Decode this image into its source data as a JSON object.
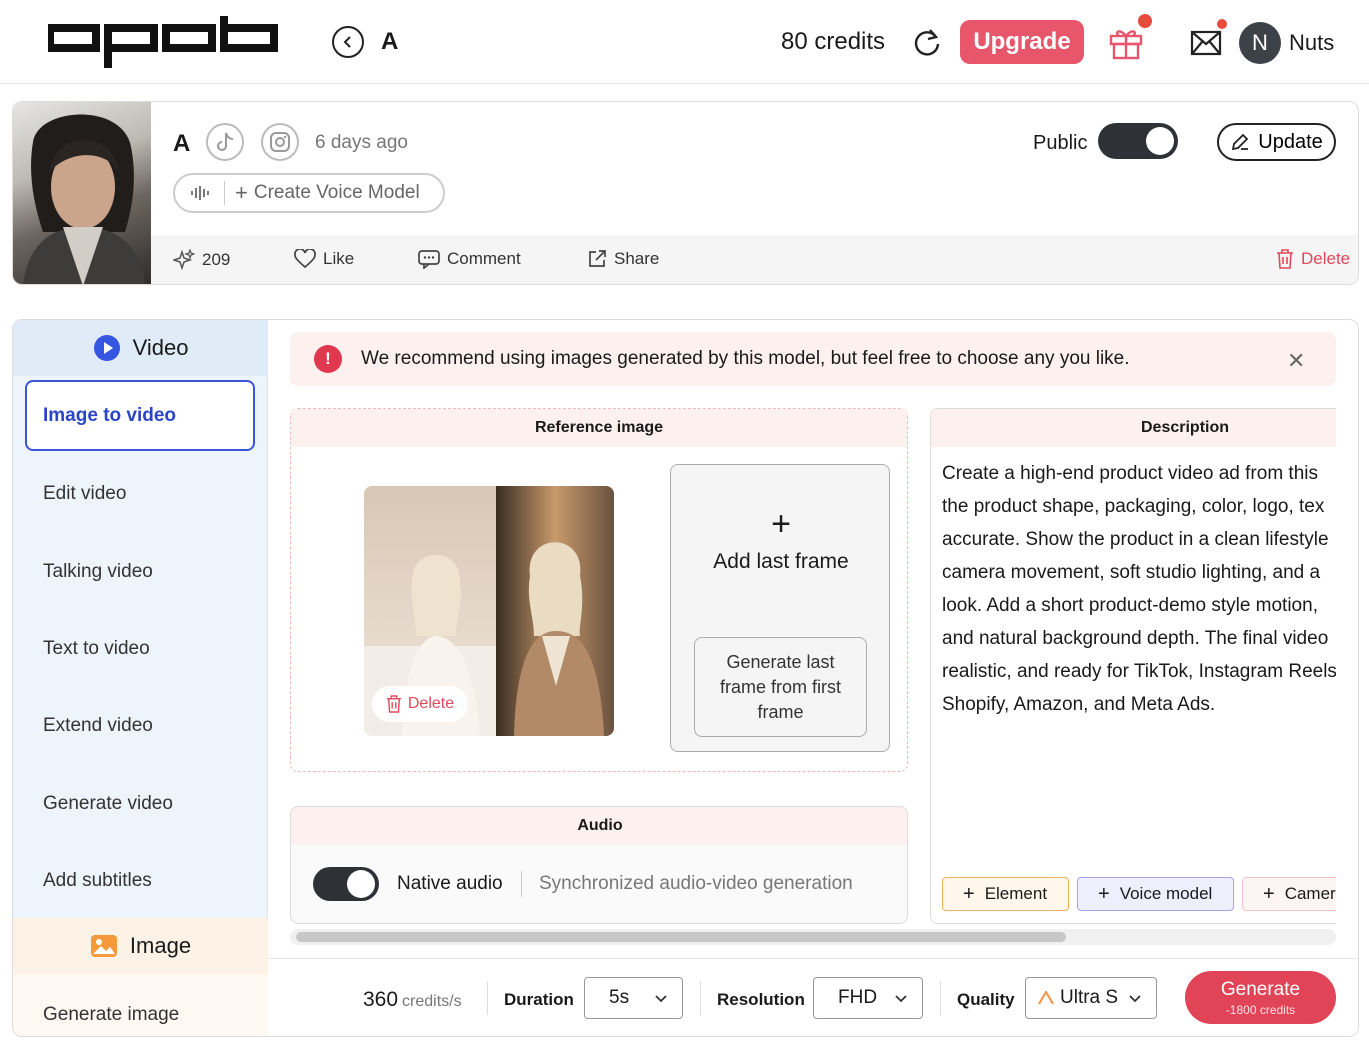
{
  "header": {
    "title": "A",
    "credits": "80 credits",
    "upgrade_label": "Upgrade",
    "avatar_initial": "N",
    "username": "Nuts"
  },
  "profile": {
    "name": "A",
    "time_ago": "6 days ago",
    "voice_model_label": "Create Voice Model",
    "public_label": "Public",
    "public_on": true,
    "update_label": "Update",
    "actions": {
      "generations": "209",
      "like": "Like",
      "comment": "Comment",
      "share": "Share",
      "delete": "Delete"
    }
  },
  "sidebar": {
    "video_heading": "Video",
    "video_items": [
      "Image to video",
      "Edit video",
      "Talking video",
      "Text to video",
      "Extend video",
      "Generate video",
      "Add subtitles"
    ],
    "active_index": 0,
    "image_heading": "Image",
    "image_items": [
      "Generate image"
    ]
  },
  "alert": {
    "text": "We recommend using images generated by this model, but feel free to choose any you like."
  },
  "reference": {
    "heading": "Reference image",
    "delete_label": "Delete",
    "add_last_frame": "Add last frame",
    "generate_last_frame": "Generate last frame from first frame"
  },
  "audio": {
    "heading": "Audio",
    "native_label": "Native audio",
    "native_on": true,
    "description": "Synchronized audio-video generation"
  },
  "description": {
    "heading": "Description",
    "lines": [
      "Create a high-end product video ad from this",
      "the product shape, packaging, color, logo, tex",
      "accurate. Show the product in a clean lifestyle",
      "camera movement, soft studio lighting, and a",
      "look. Add a short product-demo style motion,",
      "and natural background depth. The final video",
      "realistic, and ready for TikTok, Instagram Reels",
      "Shopify, Amazon, and Meta Ads."
    ],
    "chips": [
      "Element",
      "Voice model",
      "Camera"
    ]
  },
  "bottom": {
    "rate_value": "360",
    "rate_unit": "credits/s",
    "duration_label": "Duration",
    "duration_value": "5s",
    "resolution_label": "Resolution",
    "resolution_value": "FHD",
    "quality_label": "Quality",
    "quality_value": "Ultra S",
    "generate_label": "Generate",
    "generate_cost": "-1800 credits"
  },
  "colors": {
    "accent_red": "#e14456",
    "active_blue": "#2a45c9",
    "toggle_dark": "#2f3136"
  }
}
